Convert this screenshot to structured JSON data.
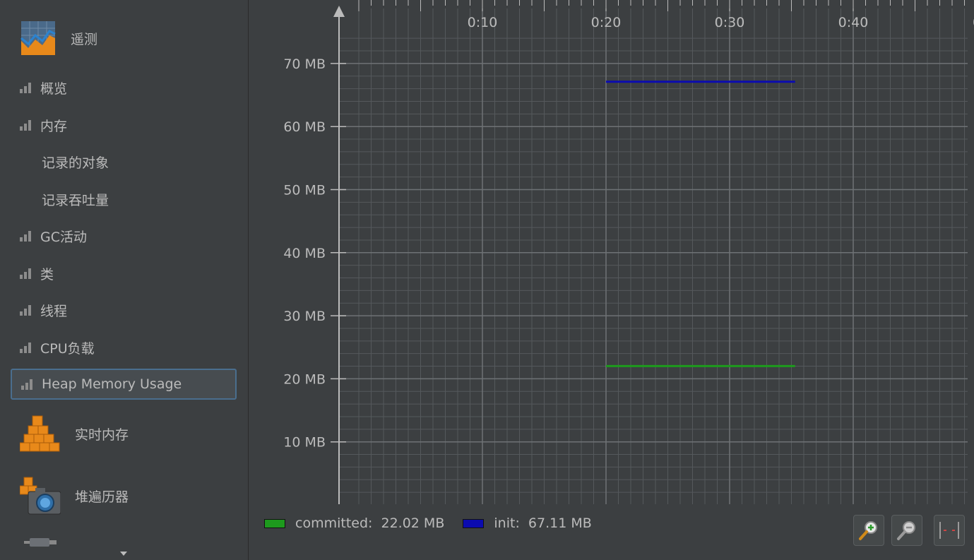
{
  "sidebar": {
    "header": {
      "label": "遥测",
      "icon": "telemetry-chart-icon"
    },
    "items": [
      {
        "label": "概览",
        "icon": "bar-chart-icon",
        "indent": false,
        "selected": false
      },
      {
        "label": "内存",
        "icon": "bar-chart-icon",
        "indent": false,
        "selected": false
      },
      {
        "label": "记录的对象",
        "icon": "",
        "indent": true,
        "selected": false
      },
      {
        "label": "记录吞吐量",
        "icon": "",
        "indent": true,
        "selected": false
      },
      {
        "label": "GC活动",
        "icon": "bar-chart-icon",
        "indent": false,
        "selected": false
      },
      {
        "label": "类",
        "icon": "bar-chart-icon",
        "indent": false,
        "selected": false
      },
      {
        "label": "线程",
        "icon": "bar-chart-icon",
        "indent": false,
        "selected": false
      },
      {
        "label": "CPU负载",
        "icon": "bar-chart-icon",
        "indent": false,
        "selected": false
      },
      {
        "label": "Heap Memory Usage",
        "icon": "bar-chart-icon",
        "indent": false,
        "selected": true
      }
    ],
    "sections": [
      {
        "label": "实时内存",
        "icon": "orange-cubes-icon"
      },
      {
        "label": "堆遍历器",
        "icon": "camera-cubes-icon"
      }
    ],
    "partial_icon": "plug-icon",
    "scroll_icon": "chevron-down-icon"
  },
  "chart_data": {
    "type": "line",
    "title": "",
    "xlabel": "",
    "ylabel": "",
    "x_ticks": [
      "0:10",
      "0:20",
      "0:30",
      "0:40",
      "0"
    ],
    "x_tick_seconds": [
      10,
      20,
      30,
      40,
      50
    ],
    "xlim_seconds": [
      0,
      51
    ],
    "y_ticks": [
      "10 MB",
      "20 MB",
      "30 MB",
      "40 MB",
      "50 MB",
      "60 MB",
      "70 MB"
    ],
    "y_tick_values": [
      10,
      20,
      30,
      40,
      50,
      60,
      70
    ],
    "ylim": [
      0,
      70
    ],
    "grid": true,
    "legend_position": "bottom-left",
    "series": [
      {
        "name": "committed",
        "value_label": "22.02 MB",
        "color": "#1d9a1d",
        "x": [
          20,
          35.3
        ],
        "y": [
          22.02,
          22.02
        ]
      },
      {
        "name": "init",
        "value_label": "67.11 MB",
        "color": "#0b0bb0",
        "x": [
          20,
          35.3
        ],
        "y": [
          67.11,
          67.11
        ]
      }
    ]
  },
  "toolbar": {
    "buttons": [
      {
        "name": "zoom-in-button",
        "icon": "zoom-in-icon"
      },
      {
        "name": "zoom-out-button",
        "icon": "zoom-out-icon"
      },
      {
        "name": "fit-button",
        "icon": "fit-width-icon"
      }
    ]
  }
}
